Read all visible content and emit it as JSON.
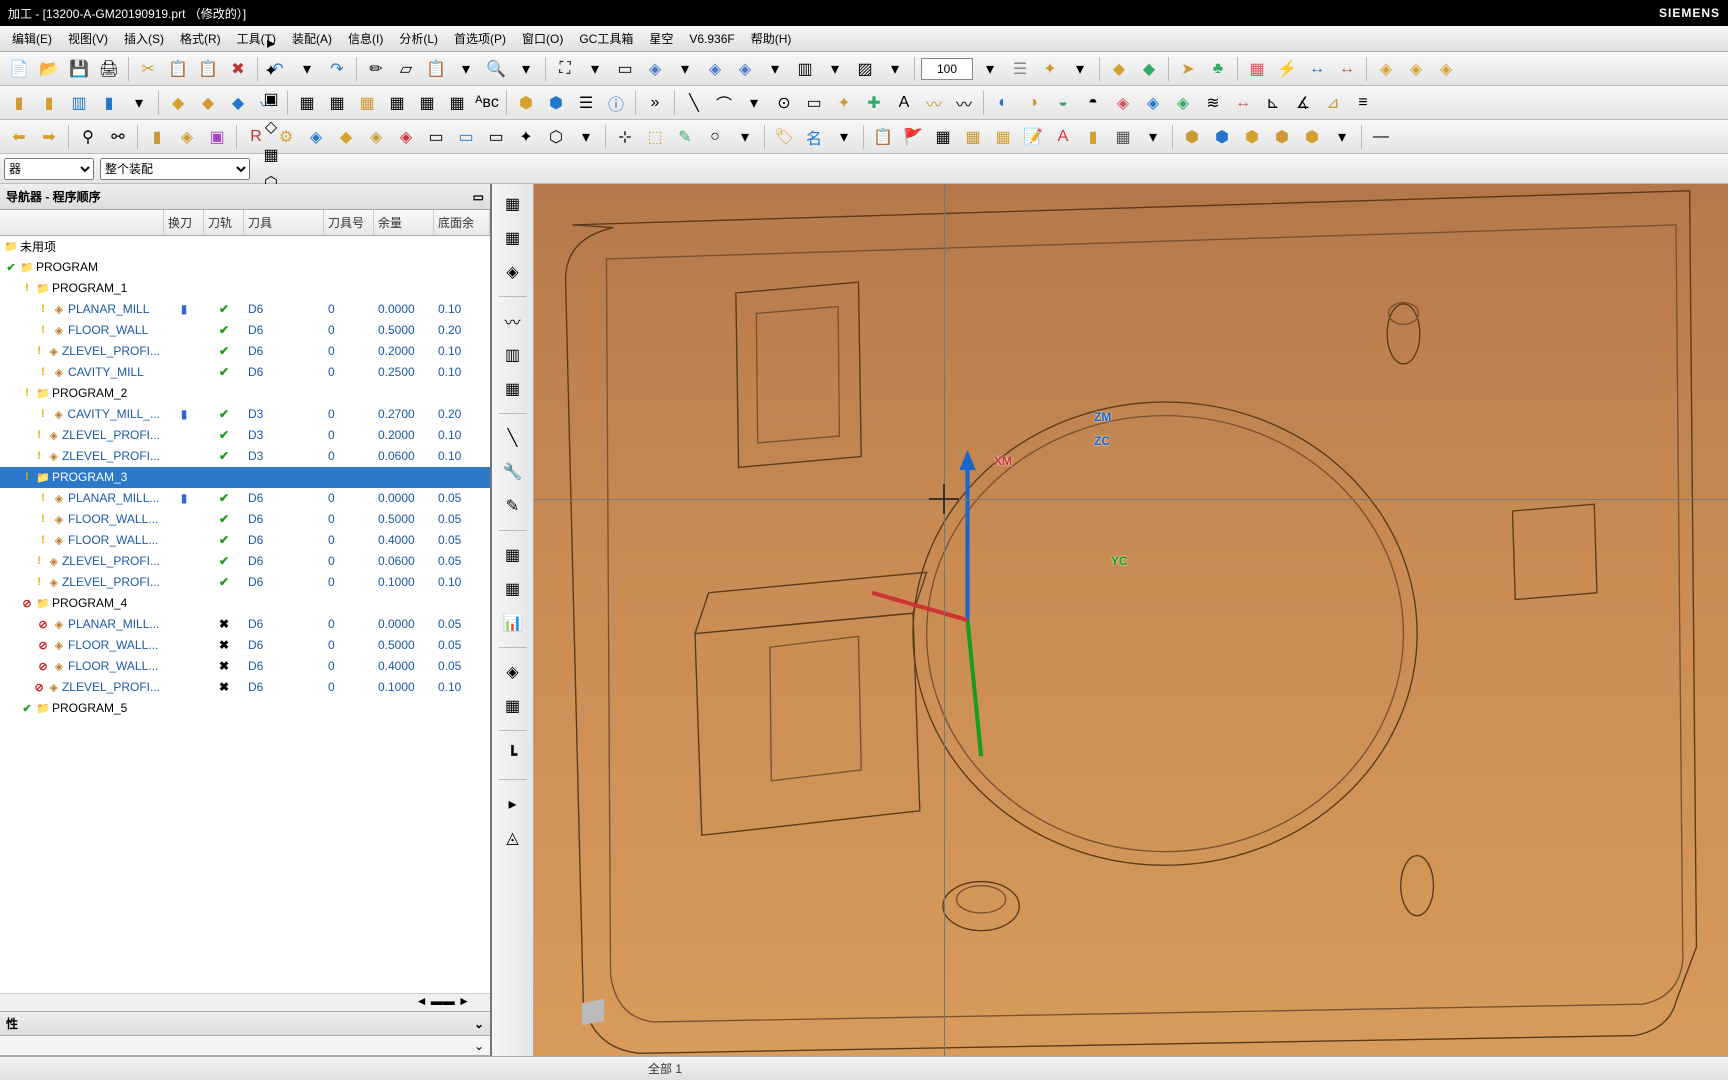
{
  "title": "加工 - [13200-A-GM20190919.prt （修改的）]",
  "brand": "SIEMENS",
  "menu": [
    "编辑(E)",
    "视图(V)",
    "插入(S)",
    "格式(R)",
    "工具(T)",
    "装配(A)",
    "信息(I)",
    "分析(L)",
    "首选项(P)",
    "窗口(O)",
    "GC工具箱",
    "星空",
    "V6.936F",
    "帮助(H)"
  ],
  "toolbar_zoom_value": "100",
  "filter_sel1": "器",
  "filter_sel2": "整个装配",
  "panel_title": "导航器 - 程序顺序",
  "columns": {
    "name": "",
    "swap": "换刀",
    "path": "刀轨",
    "tool": "刀具",
    "num": "刀具号",
    "rem": "余量",
    "bot": "底面余"
  },
  "tree": [
    {
      "type": "root",
      "glyph": "📁",
      "indent": 0,
      "name": "未用项"
    },
    {
      "type": "prog",
      "glyph": "📁",
      "indent": 0,
      "status": "ok",
      "name": "PROGRAM"
    },
    {
      "type": "prog",
      "glyph": "📁",
      "indent": 1,
      "status": "warn",
      "name": "PROGRAM_1"
    },
    {
      "type": "op",
      "indent": 2,
      "status": "warn",
      "name": "PLANAR_MILL",
      "swap": "▮",
      "path": "ok",
      "tool": "D6",
      "num": "0",
      "rem": "0.0000",
      "bot": "0.10"
    },
    {
      "type": "op",
      "indent": 2,
      "status": "warn",
      "name": "FLOOR_WALL",
      "path": "ok",
      "tool": "D6",
      "num": "0",
      "rem": "0.5000",
      "bot": "0.20"
    },
    {
      "type": "op",
      "indent": 2,
      "status": "warn",
      "name": "ZLEVEL_PROFI...",
      "path": "ok",
      "tool": "D6",
      "num": "0",
      "rem": "0.2000",
      "bot": "0.10"
    },
    {
      "type": "op",
      "indent": 2,
      "status": "warn",
      "name": "CAVITY_MILL",
      "path": "ok",
      "tool": "D6",
      "num": "0",
      "rem": "0.2500",
      "bot": "0.10"
    },
    {
      "type": "prog",
      "glyph": "📁",
      "indent": 1,
      "status": "warn",
      "name": "PROGRAM_2"
    },
    {
      "type": "op",
      "indent": 2,
      "status": "warn",
      "name": "CAVITY_MILL_...",
      "swap": "▮",
      "path": "ok",
      "tool": "D3",
      "num": "0",
      "rem": "0.2700",
      "bot": "0.20"
    },
    {
      "type": "op",
      "indent": 2,
      "status": "warn",
      "name": "ZLEVEL_PROFI...",
      "path": "ok",
      "tool": "D3",
      "num": "0",
      "rem": "0.2000",
      "bot": "0.10"
    },
    {
      "type": "op",
      "indent": 2,
      "status": "warn",
      "name": "ZLEVEL_PROFI...",
      "path": "ok",
      "tool": "D3",
      "num": "0",
      "rem": "0.0600",
      "bot": "0.10"
    },
    {
      "type": "prog",
      "glyph": "📁",
      "indent": 1,
      "status": "warn",
      "name": "PROGRAM_3",
      "selected": true
    },
    {
      "type": "op",
      "indent": 2,
      "status": "warn",
      "name": "PLANAR_MILL...",
      "swap": "▮",
      "path": "ok",
      "tool": "D6",
      "num": "0",
      "rem": "0.0000",
      "bot": "0.05"
    },
    {
      "type": "op",
      "indent": 2,
      "status": "warn",
      "name": "FLOOR_WALL...",
      "path": "ok",
      "tool": "D6",
      "num": "0",
      "rem": "0.5000",
      "bot": "0.05"
    },
    {
      "type": "op",
      "indent": 2,
      "status": "warn",
      "name": "FLOOR_WALL...",
      "path": "ok",
      "tool": "D6",
      "num": "0",
      "rem": "0.4000",
      "bot": "0.05"
    },
    {
      "type": "op",
      "indent": 2,
      "status": "warn",
      "name": "ZLEVEL_PROFI...",
      "path": "ok",
      "tool": "D6",
      "num": "0",
      "rem": "0.0600",
      "bot": "0.05"
    },
    {
      "type": "op",
      "indent": 2,
      "status": "warn",
      "name": "ZLEVEL_PROFI...",
      "path": "ok",
      "tool": "D6",
      "num": "0",
      "rem": "0.1000",
      "bot": "0.10"
    },
    {
      "type": "prog",
      "glyph": "📁",
      "indent": 1,
      "status": "stop",
      "name": "PROGRAM_4"
    },
    {
      "type": "op",
      "indent": 2,
      "status": "stop",
      "name": "PLANAR_MILL...",
      "path": "x",
      "tool": "D6",
      "num": "0",
      "rem": "0.0000",
      "bot": "0.05"
    },
    {
      "type": "op",
      "indent": 2,
      "status": "stop",
      "name": "FLOOR_WALL...",
      "path": "x",
      "tool": "D6",
      "num": "0",
      "rem": "0.5000",
      "bot": "0.05"
    },
    {
      "type": "op",
      "indent": 2,
      "status": "stop",
      "name": "FLOOR_WALL...",
      "path": "x",
      "tool": "D6",
      "num": "0",
      "rem": "0.4000",
      "bot": "0.05"
    },
    {
      "type": "op",
      "indent": 2,
      "status": "stop",
      "name": "ZLEVEL_PROFI...",
      "path": "x",
      "tool": "D6",
      "num": "0",
      "rem": "0.1000",
      "bot": "0.10"
    },
    {
      "type": "prog",
      "glyph": "📁",
      "indent": 1,
      "status": "ok",
      "name": "PROGRAM_5"
    }
  ],
  "props_title": "性",
  "axis": {
    "zm": "ZM",
    "zc": "ZC",
    "yc": "YC",
    "xm": "XM"
  },
  "status_text": "全部 1"
}
